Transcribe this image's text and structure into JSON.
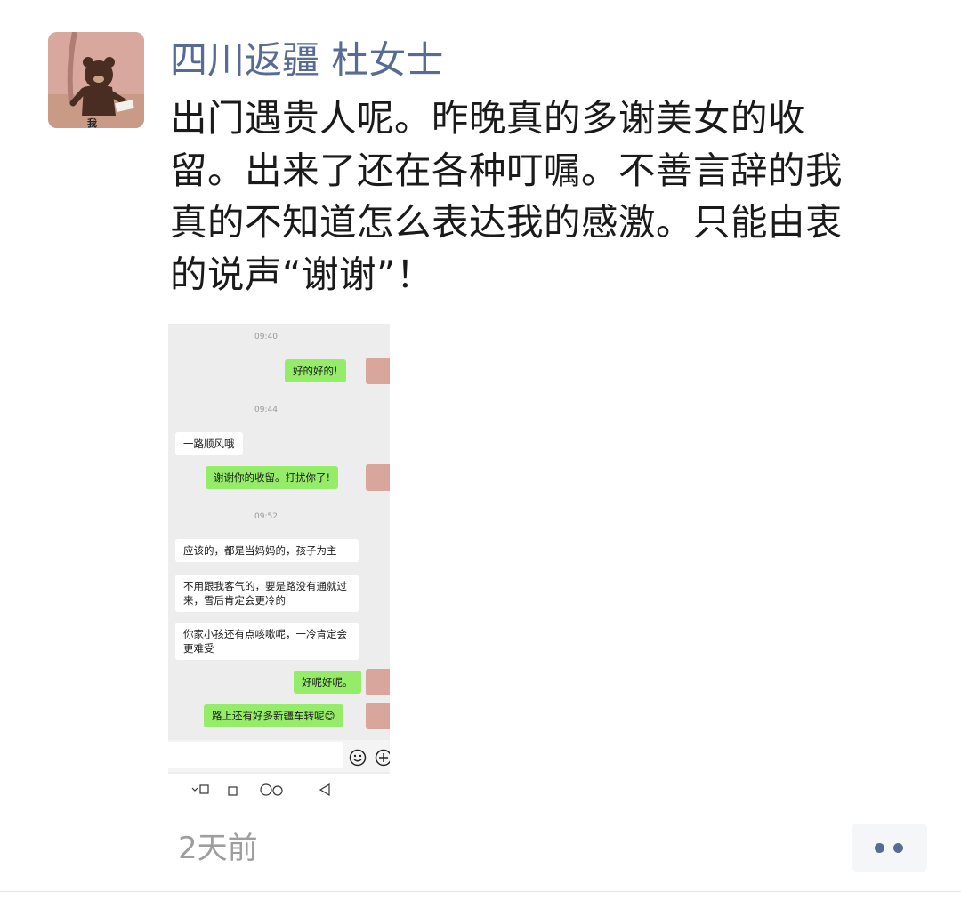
{
  "post": {
    "author": "四川返疆 杜女士",
    "avatar_label": "我",
    "text_lines": [
      "出门遇贵人呢。昨晚真的多谢美女的收",
      "留。出来了还在各种叮嘱。不善言辞的我",
      "真的不知道怎么表达我的感激。只能由衷",
      "的说声“谢谢”！"
    ],
    "time": "2天前"
  },
  "screenshot": {
    "messages": [
      {
        "type": "time",
        "text": "09:40"
      },
      {
        "type": "out",
        "text": "好的好的!"
      },
      {
        "type": "time",
        "text": "09:44"
      },
      {
        "type": "in",
        "text": "一路顺风哦"
      },
      {
        "type": "out",
        "text": "谢谢你的收留。打扰你了!"
      },
      {
        "type": "time",
        "text": "09:52"
      },
      {
        "type": "in",
        "text": "应该的，都是当妈妈的，孩子为主"
      },
      {
        "type": "in",
        "text": "不用跟我客气的，要是路没有通就过来，雪后肯定会更冷的"
      },
      {
        "type": "in",
        "text": "你家小孩还有点咳嗽呢，一冷肯定会更难受"
      },
      {
        "type": "out",
        "text": "好呢好呢。"
      },
      {
        "type": "out",
        "text": "路上还有好多新疆车转呢😊"
      }
    ]
  },
  "colors": {
    "author": "#576b95",
    "text": "#1a1a1a",
    "time": "#9e9e9e",
    "bubble_out": "#95ec69",
    "bubble_in": "#ffffff",
    "chat_bg": "#ededed"
  },
  "icons": [
    "bear-avatar-icon",
    "emoji-icon",
    "plus-icon",
    "more-dots-icon",
    "back-nav-icon",
    "home-nav-icon",
    "recent-nav-icon"
  ]
}
